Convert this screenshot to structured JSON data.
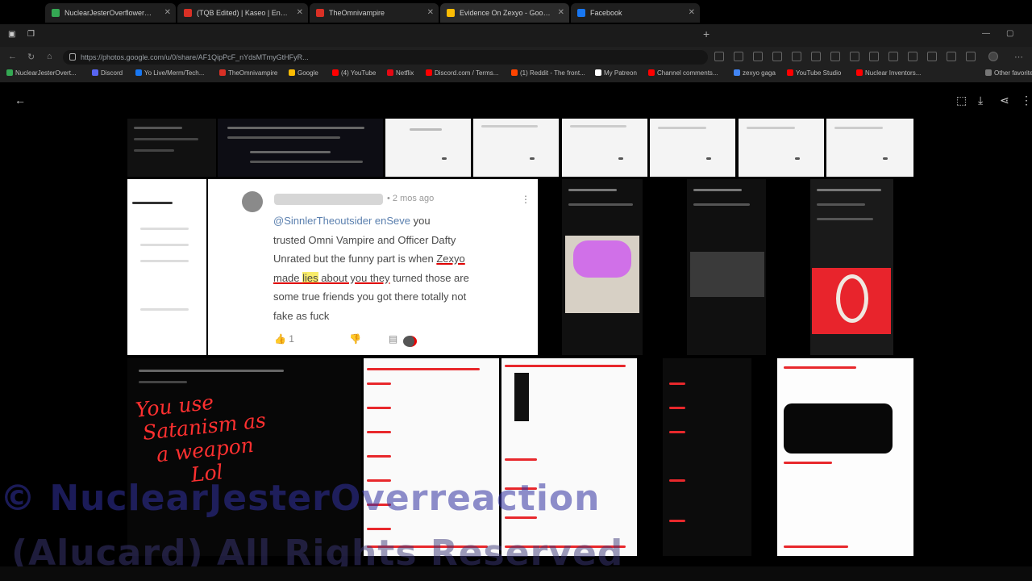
{
  "browser": {
    "tabs": [
      {
        "label": "NuclearJesterOverflower@Ke",
        "color": "#34a853"
      },
      {
        "label": "(TQB Edited) | Kaseo | Endless",
        "color": "#d93025"
      },
      {
        "label": "TheOmnivampire",
        "color": "#d93025"
      },
      {
        "label": "Evidence On Zexyo - Google Ph",
        "color": "#fbbc04"
      },
      {
        "label": "Facebook",
        "color": "#1877f2"
      }
    ],
    "new_tab_icon": "+",
    "url": "https://photos.google.com/u/0/share/AF1QipPcF_nYdsMTmyGtHFyR...",
    "bookmarks": [
      {
        "label": "NuclearJesterOvert...",
        "color": "#34a853"
      },
      {
        "label": "Discord",
        "color": "#5865f2"
      },
      {
        "label": "Yo Live/Merm/Tech...",
        "color": "#1877f2"
      },
      {
        "label": "TheOmnivampire",
        "color": "#d93025"
      },
      {
        "label": "Google",
        "color": "#fbbc04"
      },
      {
        "label": "(4) YouTube",
        "color": "#ff0000"
      },
      {
        "label": "Netflix",
        "color": "#e50914"
      },
      {
        "label": "Discord.com / Terms...",
        "color": "#ff0000"
      },
      {
        "label": "(1) Reddit - The front...",
        "color": "#ff4500"
      },
      {
        "label": "My Patreon",
        "color": "#ffffff"
      },
      {
        "label": "Channel comments...",
        "color": "#ff0000"
      },
      {
        "label": "zexyo gaga",
        "color": "#4285f4"
      },
      {
        "label": "YouTube Studio",
        "color": "#ff0000"
      },
      {
        "label": "Nuclear Inventors...",
        "color": "#ff0000"
      },
      {
        "label": "Other favorites",
        "color": "#777777"
      }
    ]
  },
  "comment": {
    "time": "• 2 mos ago",
    "mention": "@SinnlerTheoutsider enSeve",
    "text_1": " you",
    "text_2": "trusted Omni Vampire and Officer Dafty",
    "text_3": "Unrated but the funny part is when ",
    "name": "Zexyo",
    "text_4a": "made ",
    "text_4b": "lies",
    "text_4c": " about you they",
    "text_4d": " turned those are",
    "text_5": "some true friends you got there totally not",
    "text_6": "fake as fuck",
    "like_count": "1"
  },
  "handwriting": {
    "line1": "You use",
    "line2": "Satanism as",
    "line3": "a weapon",
    "line4": "Lol"
  },
  "watermark": {
    "line1": "© NuclearJesterOverreaction",
    "line2": "(Alucard) All Rights Reserved"
  },
  "colors": {
    "accent_red": "#e00000",
    "highlight_yellow": "#f8ec6a",
    "watermark_blue": "#3232a0"
  }
}
